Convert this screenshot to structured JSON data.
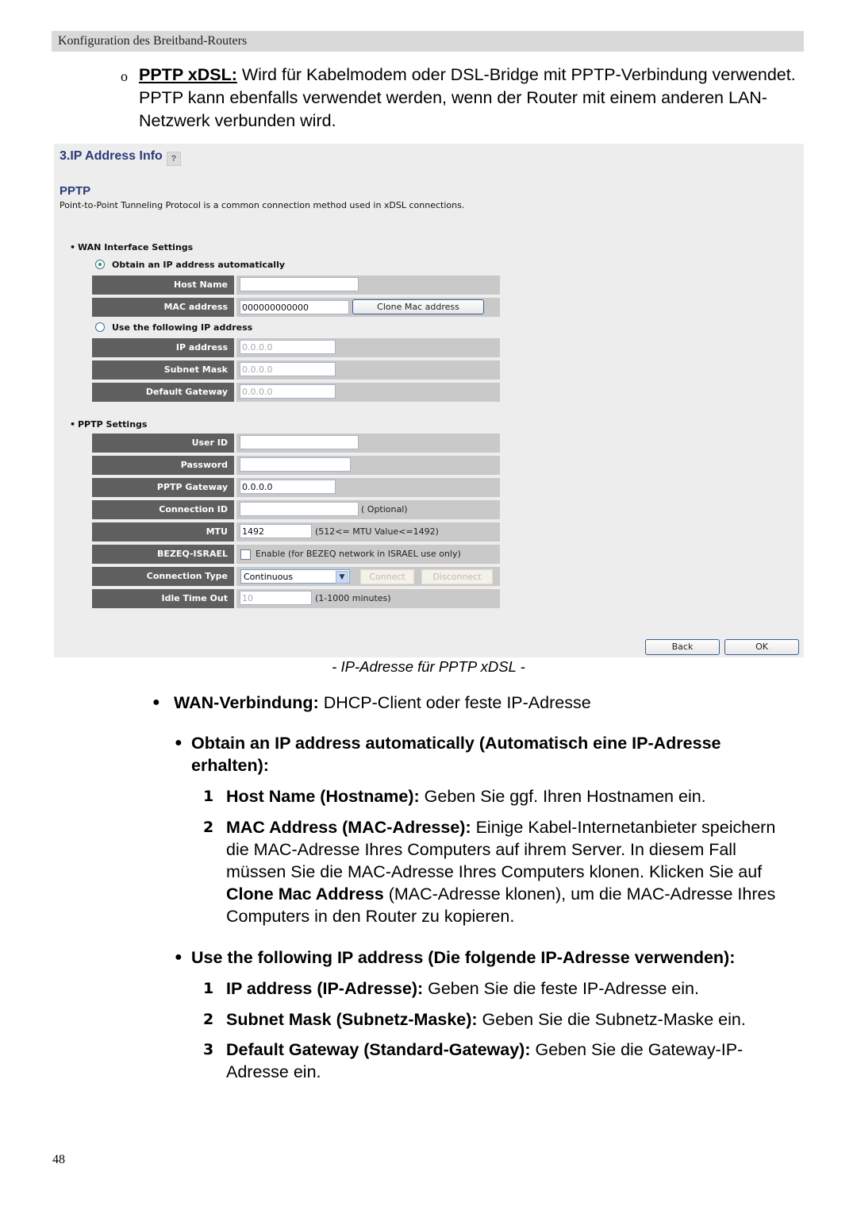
{
  "header": {
    "title": "Konfiguration des Breitband-Routers"
  },
  "intro": {
    "bullet": "o",
    "term": "PPTP xDSL:",
    "text": " Wird für Kabelmodem oder DSL-Bridge mit PPTP-Verbindung verwendet. PPTP kann ebenfalls verwendet werden, wenn der Router mit einem anderen LAN-Netzwerk verbunden wird."
  },
  "panel": {
    "title": "3.IP Address Info",
    "help_icon": "?",
    "subtitle": "PPTP",
    "description": "Point-to-Point Tunneling Protocol is a common connection method used in xDSL connections.",
    "wan_section": "WAN Interface Settings",
    "radio_auto": {
      "label": "Obtain an IP address automatically",
      "checked": true
    },
    "radio_manual": {
      "label": "Use the following IP address",
      "checked": false
    },
    "host_name": {
      "label": "Host Name",
      "value": ""
    },
    "mac_address": {
      "label": "MAC address",
      "value": "000000000000",
      "clone_button": "Clone Mac address"
    },
    "ip_address": {
      "label": "IP address",
      "value": "0.0.0.0"
    },
    "subnet_mask": {
      "label": "Subnet Mask",
      "value": "0.0.0.0"
    },
    "default_gateway": {
      "label": "Default Gateway",
      "value": "0.0.0.0"
    },
    "pptp_section": "PPTP Settings",
    "user_id": {
      "label": "User ID",
      "value": ""
    },
    "password": {
      "label": "Password",
      "value": ""
    },
    "pptp_gateway": {
      "label": "PPTP Gateway",
      "value": "0.0.0.0"
    },
    "connection_id": {
      "label": "Connection ID",
      "value": "",
      "note": "( Optional)"
    },
    "mtu": {
      "label": "MTU",
      "value": "1492",
      "note": "(512<= MTU Value<=1492)"
    },
    "bezeq": {
      "label": "BEZEQ-ISRAEL",
      "checked": false,
      "note": "Enable (for BEZEQ network in ISRAEL use only)"
    },
    "connection_type": {
      "label": "Connection Type",
      "selected": "Continuous",
      "connect_button": "Connect",
      "disconnect_button": "Disconnect"
    },
    "idle_time_out": {
      "label": "Idle Time Out",
      "value": "10",
      "note": "(1-1000 minutes)"
    },
    "back_button": "Back",
    "ok_button": "OK"
  },
  "caption": "- IP-Adresse für PPTP xDSL -",
  "body": {
    "wan": {
      "bullet": "●",
      "term": "WAN-Verbindung:",
      "text": " DHCP-Client oder feste IP-Adresse"
    },
    "auto_heading": {
      "bullet": "●",
      "text_line1": "Obtain an IP address automatically (Automatisch eine IP-Adresse",
      "text_line2": "erhalten):"
    },
    "auto_items": [
      {
        "num": "1",
        "term": "Host Name (Hostname):",
        "text": " Geben Sie ggf. Ihren Hostnamen ein."
      },
      {
        "num": "2",
        "term": "MAC Address (MAC-Adresse):",
        "text1": " Einige Kabel-Internetanbieter speichern die MAC-Adresse Ihres Computers auf ihrem Server. In diesem Fall müssen Sie die MAC-Adresse Ihres Computers klonen. Klicken Sie auf ",
        "term2": "Clone Mac Address",
        "text2": " (MAC-Adresse klonen), um die MAC-Adresse Ihres Computers in den Router zu kopieren."
      }
    ],
    "manual_heading": {
      "bullet": "●",
      "text": "Use the following IP address (Die folgende IP-Adresse verwenden):"
    },
    "manual_items": [
      {
        "num": "1",
        "term": "IP address (IP-Adresse):",
        "text": " Geben Sie die feste IP-Adresse ein."
      },
      {
        "num": "2",
        "term": "Subnet Mask (Subnetz-Maske):",
        "text": " Geben Sie die Subnetz-Maske ein."
      },
      {
        "num": "3",
        "term": "Default Gateway (Standard-Gateway):",
        "text": " Geben Sie die Gateway-IP-Adresse ein."
      }
    ]
  },
  "page_number": "48"
}
